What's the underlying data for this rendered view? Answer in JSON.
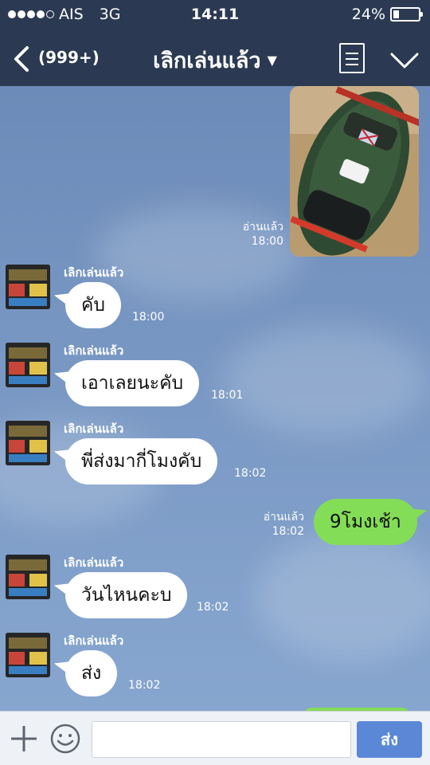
{
  "status_bar": {
    "carrier": "AIS",
    "network": "3G",
    "time": "14:11",
    "battery_text": "24%",
    "battery_level": 0.24
  },
  "header": {
    "back_count": "(999+)",
    "title": "เลิกเล่นแล้ว",
    "icons": [
      "back-chevron-icon",
      "caret-down-icon",
      "notes-icon",
      "chevron-down-icon"
    ]
  },
  "chat": {
    "photo_message": {
      "read": "อ่านแล้ว",
      "time": "18:00"
    },
    "messages": [
      {
        "sender": "เลิกเล่นแล้ว",
        "text": "คับ",
        "time": "18:00"
      },
      {
        "sender": "เลิกเล่นแล้ว",
        "text": "เอาเลยนะคับ",
        "time": "18:01"
      },
      {
        "sender": "เลิกเล่นแล้ว",
        "text": "พี่ส่งมากี่โมงคับ",
        "time": "18:02"
      },
      {
        "text": "9โมงเช้า",
        "read": "อ่านแล้ว",
        "time": "18:02"
      },
      {
        "sender": "เลิกเล่นแล้ว",
        "text": "วันไหนคะบ",
        "time": "18:02"
      },
      {
        "sender": "เลิกเล่นแล้ว",
        "text": "ส่ง",
        "time": "18:02"
      }
    ]
  },
  "input_bar": {
    "placeholder": "",
    "send_label": "ส่ง",
    "icons": [
      "plus-icon",
      "emoji-icon"
    ]
  },
  "colors": {
    "header_bg": "#2b3a52",
    "incoming_bubble": "#ffffff",
    "outgoing_bubble": "#84dd56",
    "send_button": "#5b88d6"
  }
}
